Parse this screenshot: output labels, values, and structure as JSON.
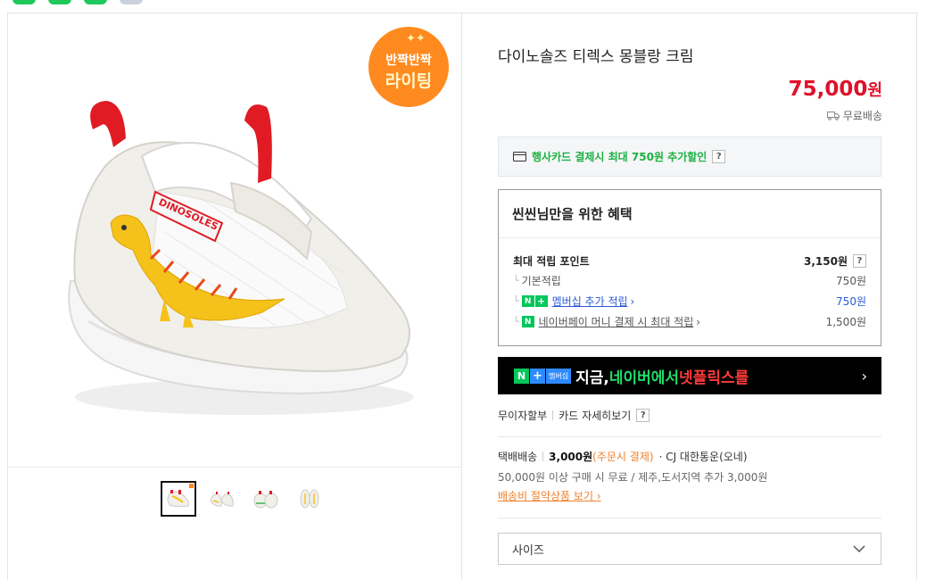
{
  "top_pills": [
    {
      "color": "#1ec85a"
    },
    {
      "color": "#1ec85a"
    },
    {
      "color": "#1ec85a"
    },
    {
      "color": "#c9d1dc"
    }
  ],
  "gallery": {
    "badge": {
      "line1": "반짝반짝",
      "line2": "라이팅",
      "color": "#ff8a1f"
    },
    "thumbnails": [
      "shoe-thumb-side",
      "shoe-thumb-pair",
      "shoe-thumb-front",
      "shoe-thumb-top"
    ]
  },
  "product": {
    "title": "다이노솔즈 티렉스 몽블랑 크림",
    "price": "75,000",
    "currency": "원",
    "shipping_free": "무료배송"
  },
  "card_promo": {
    "text": "행사카드 결제시 최대 750원 추가할인",
    "help": "?"
  },
  "benefit": {
    "heading": "씬씬님만을 위한 혜택",
    "max_points_label": "최대 적립 포인트",
    "max_points_value": "3,150원",
    "help": "?",
    "basic_label": "기본적립",
    "basic_value": "750원",
    "membership_label": "멤버십 추가 적립",
    "membership_value": "750원",
    "naverpay_label": "네이버페이 머니 결제 시 최대 적립",
    "naverpay_value": "1,500원"
  },
  "banner": {
    "membership_tag": "멤버십",
    "text1": "지금, ",
    "text2": "네이버에서 ",
    "text3": "넷플릭스를"
  },
  "installment": {
    "label": "무이자할부",
    "card_detail": "카드 자세히보기",
    "help": "?"
  },
  "shipping": {
    "method": "택배배송",
    "fee": "3,000원",
    "fee_note": "(주문시 결제)",
    "carrier": "· CJ 대한통운(오네)",
    "condition": "50,000원 이상 구매 시 무료 / 제주,도서지역 추가 3,000원",
    "saving_link": "배송비 절약상품 보기"
  },
  "option": {
    "size_label": "사이즈"
  },
  "colors": {
    "price_red": "#e0112b",
    "naver_green": "#03c75a",
    "promo_green": "#1db142",
    "orange_link": "#f0802b"
  }
}
